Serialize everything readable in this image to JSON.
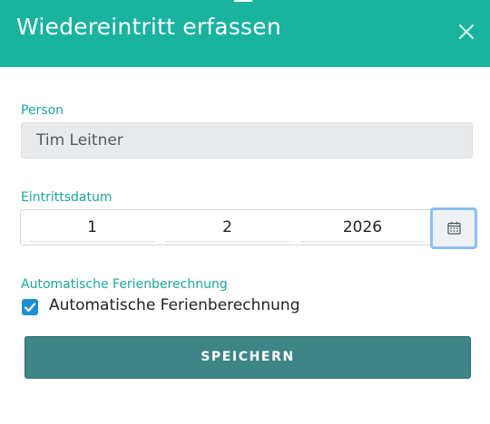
{
  "dialog": {
    "title": "Wiedereintritt erfassen",
    "close_icon": "close-icon"
  },
  "person": {
    "label": "Person",
    "value": "Tim Leitner"
  },
  "entry_date": {
    "label": "Eintrittsdatum",
    "day": "1",
    "month": "2",
    "year": "2026",
    "calendar_icon": "calendar-icon"
  },
  "vacation": {
    "section_label": "Automatische Ferienberechnung",
    "checkbox_label": "Automatische Ferienberechnung",
    "checked": true
  },
  "actions": {
    "save_label": "SPEICHERN"
  },
  "colors": {
    "header": "#19b3a0",
    "label": "#19a997",
    "save_button": "#3d8587",
    "checkbox": "#1a8fd8",
    "calendar_focus": "#8dbff2"
  }
}
